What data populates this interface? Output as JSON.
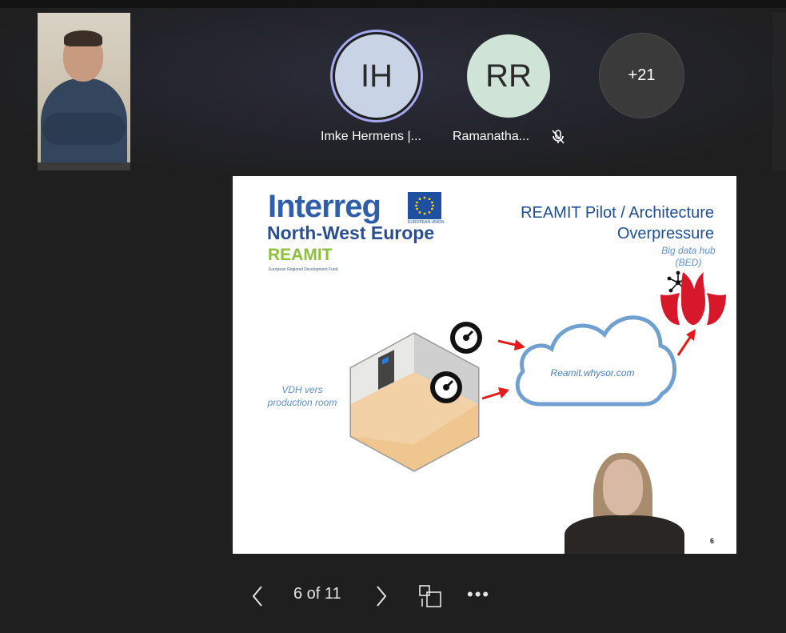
{
  "participants": [
    {
      "initials": "IH",
      "name": "Imke Hermens |..."
    },
    {
      "initials": "RR",
      "name": "Ramanatha..."
    }
  ],
  "overflow_count": "+21",
  "slide": {
    "logo_interreg": "Interreg",
    "logo_eu_text": "EUROPEAN UNION",
    "logo_nwe": "North-West Europe",
    "logo_reamit": "REAMIT",
    "logo_erdf": "European Regional Development Fund",
    "title_line1": "REAMIT Pilot / Architecture",
    "title_line2": "Overpressure",
    "big_data_hub": "Big data hub",
    "bed": "(BED)",
    "vdh_line1": "VDH vers",
    "vdh_line2": "production room",
    "cloud_label": "Reamit.whysor.com",
    "number": "6"
  },
  "controls": {
    "counter": "6 of 11",
    "more": "•••"
  },
  "colors": {
    "ih_avatar": "#c9d3e6",
    "rr_avatar": "#cfe3d6",
    "speaking_ring": "#a6a8f0",
    "slide_blue": "#1d4f91",
    "cloud_blue": "#6fa0cf",
    "arrow_red": "#e31b1b",
    "hub_red": "#d7182a"
  }
}
